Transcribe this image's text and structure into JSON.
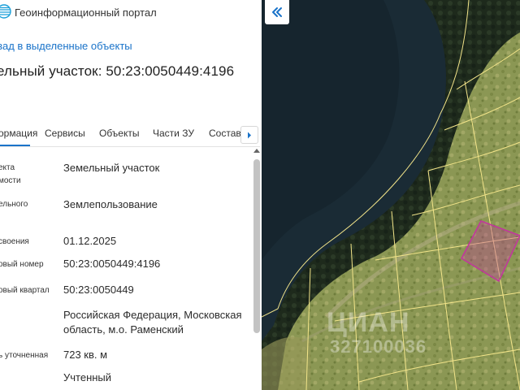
{
  "header": {
    "title": "Геоинформационный портал",
    "logo_icon": "globe-icon"
  },
  "back_link": "зад в выделенные объекты",
  "object_title": "ельный участок: 50:23:0050449:4196",
  "tabs": [
    {
      "label": "ормация",
      "active": true
    },
    {
      "label": "Сервисы",
      "active": false
    },
    {
      "label": "Объекты",
      "active": false
    },
    {
      "label": "Части ЗУ",
      "active": false
    },
    {
      "label": "Состав",
      "active": false
    }
  ],
  "properties": [
    {
      "label_lines": [
        "екта",
        "мости"
      ],
      "value": "Земельный участок"
    },
    {
      "label_lines": [
        "ельного"
      ],
      "value": "Землепользование"
    },
    {
      "label_lines": [
        "своения"
      ],
      "value": "01.12.2025"
    },
    {
      "label_lines": [
        "овый номер"
      ],
      "value": "50:23:0050449:4196"
    },
    {
      "label_lines": [
        "овый квартал"
      ],
      "value": "50:23:0050449"
    },
    {
      "label_lines": [],
      "value": "Российская Федерация, Московская область, м.о. Раменский"
    },
    {
      "label_lines": [
        "ь уточненная"
      ],
      "value": "723 кв. м"
    },
    {
      "label_lines": [],
      "value": "Учтенный"
    }
  ],
  "map": {
    "watermark": "ЦИАН",
    "watermark_sub": "327100036",
    "selection_color": "#c1379c",
    "boundary_color": "#f3e58a",
    "collapse_icon": "double-chevron-left-icon"
  },
  "colors": {
    "accent": "#1a73c9"
  }
}
